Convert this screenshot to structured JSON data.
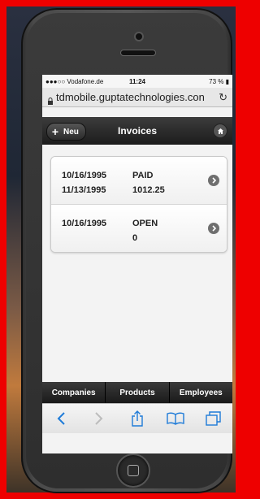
{
  "status_bar": {
    "carrier": "●●●○○ Vodafone.de",
    "time": "11:24",
    "battery": "73 %"
  },
  "browser": {
    "url": "tdmobile.guptatechnologies.con"
  },
  "header": {
    "new_label": "Neu",
    "title": "Invoices"
  },
  "invoices": [
    {
      "date": "10/16/1995",
      "due": "11/13/1995",
      "status": "PAID",
      "amount": "1012.25"
    },
    {
      "date": "10/16/1995",
      "due": "",
      "status": "OPEN",
      "amount": "0"
    }
  ],
  "nav": {
    "items": [
      "Companies",
      "Products",
      "Employees"
    ]
  },
  "colors": {
    "frame": "#e00000",
    "header_bg": "#1c1c1c",
    "list_bg": "#ffffff"
  }
}
